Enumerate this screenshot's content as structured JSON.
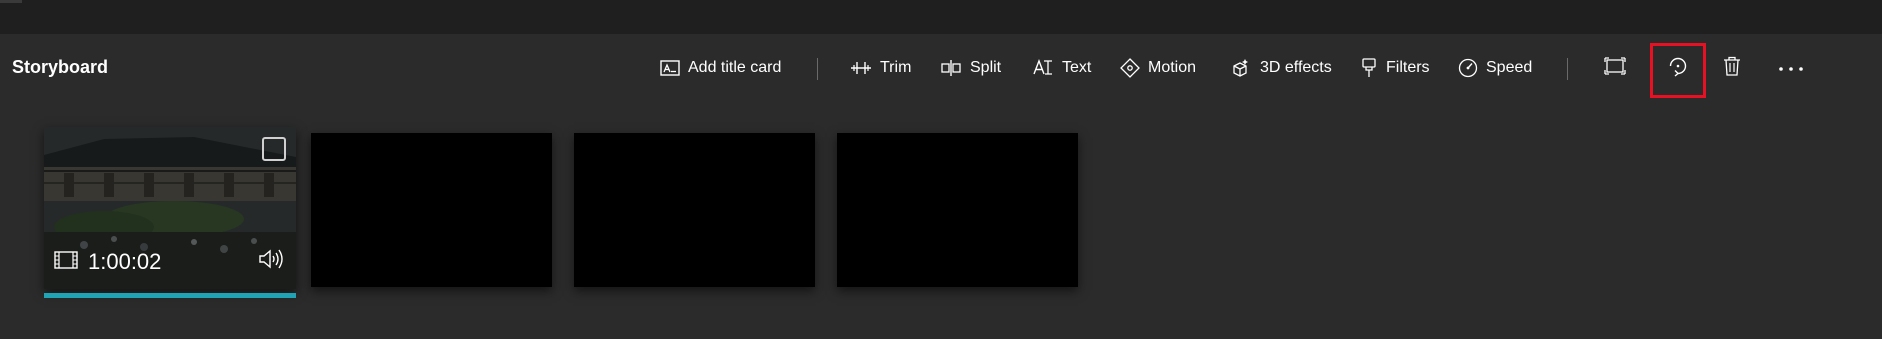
{
  "header": {
    "title": "Storyboard"
  },
  "toolbar": {
    "add_title_card": "Add title card",
    "trim": "Trim",
    "split": "Split",
    "text": "Text",
    "motion": "Motion",
    "effects_3d": "3D effects",
    "filters": "Filters",
    "speed": "Speed"
  },
  "icons": {
    "add_title_card": "title-card-icon",
    "trim": "trim-icon",
    "split": "split-icon",
    "text": "text-icon",
    "motion": "motion-icon",
    "effects_3d": "3d-effects-icon",
    "filters": "filters-icon",
    "speed": "speed-icon",
    "resize": "resize-icon",
    "rotate": "rotate-icon",
    "delete": "delete-icon",
    "more": "more-icon"
  },
  "clips": [
    {
      "duration": "1:00:02",
      "has_thumbnail": true,
      "selected": false
    },
    {
      "duration": "",
      "has_thumbnail": false
    },
    {
      "duration": "",
      "has_thumbnail": false
    },
    {
      "duration": "",
      "has_thumbnail": false
    }
  ],
  "colors": {
    "background": "#2b2b2b",
    "topbar": "#1f1f1f",
    "highlight": "#e81123",
    "progress": "#1fa3b5"
  }
}
